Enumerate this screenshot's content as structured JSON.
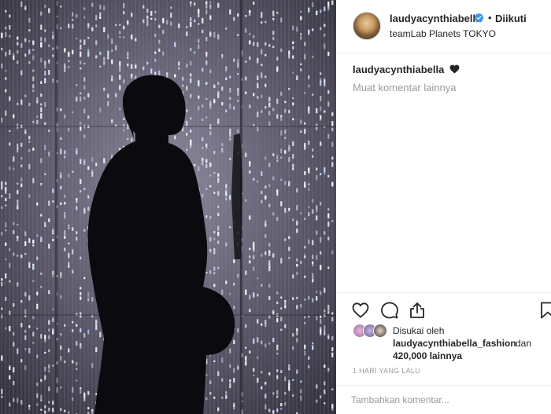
{
  "post": {
    "username": "laudyacynthiabella",
    "dot": "•",
    "follow_status": "Diikuti",
    "location": "teamLab Planets TOKYO",
    "verified_icon": "verified-badge-icon",
    "avatar_icon": "avatar"
  },
  "caption": {
    "username": "laudyacynthiabella",
    "emoji": "black-heart-icon"
  },
  "comments": {
    "load_more": "Muat komentar lainnya"
  },
  "actions": {
    "icons": [
      "heart-icon",
      "comment-icon",
      "share-icon",
      "bookmark-icon"
    ]
  },
  "likes": {
    "prefix": "Disukai oleh",
    "user": "laudyacynthiabella_fashion",
    "conjunction": "dan",
    "count_text": "420,000 lainnya"
  },
  "timestamp": "1 HARI YANG LALU",
  "comment_input": {
    "placeholder": "Tambahkan komentar..."
  },
  "colors": {
    "text": "#262626",
    "muted": "#999999",
    "border": "#efefef",
    "verified": "#3897f0"
  }
}
